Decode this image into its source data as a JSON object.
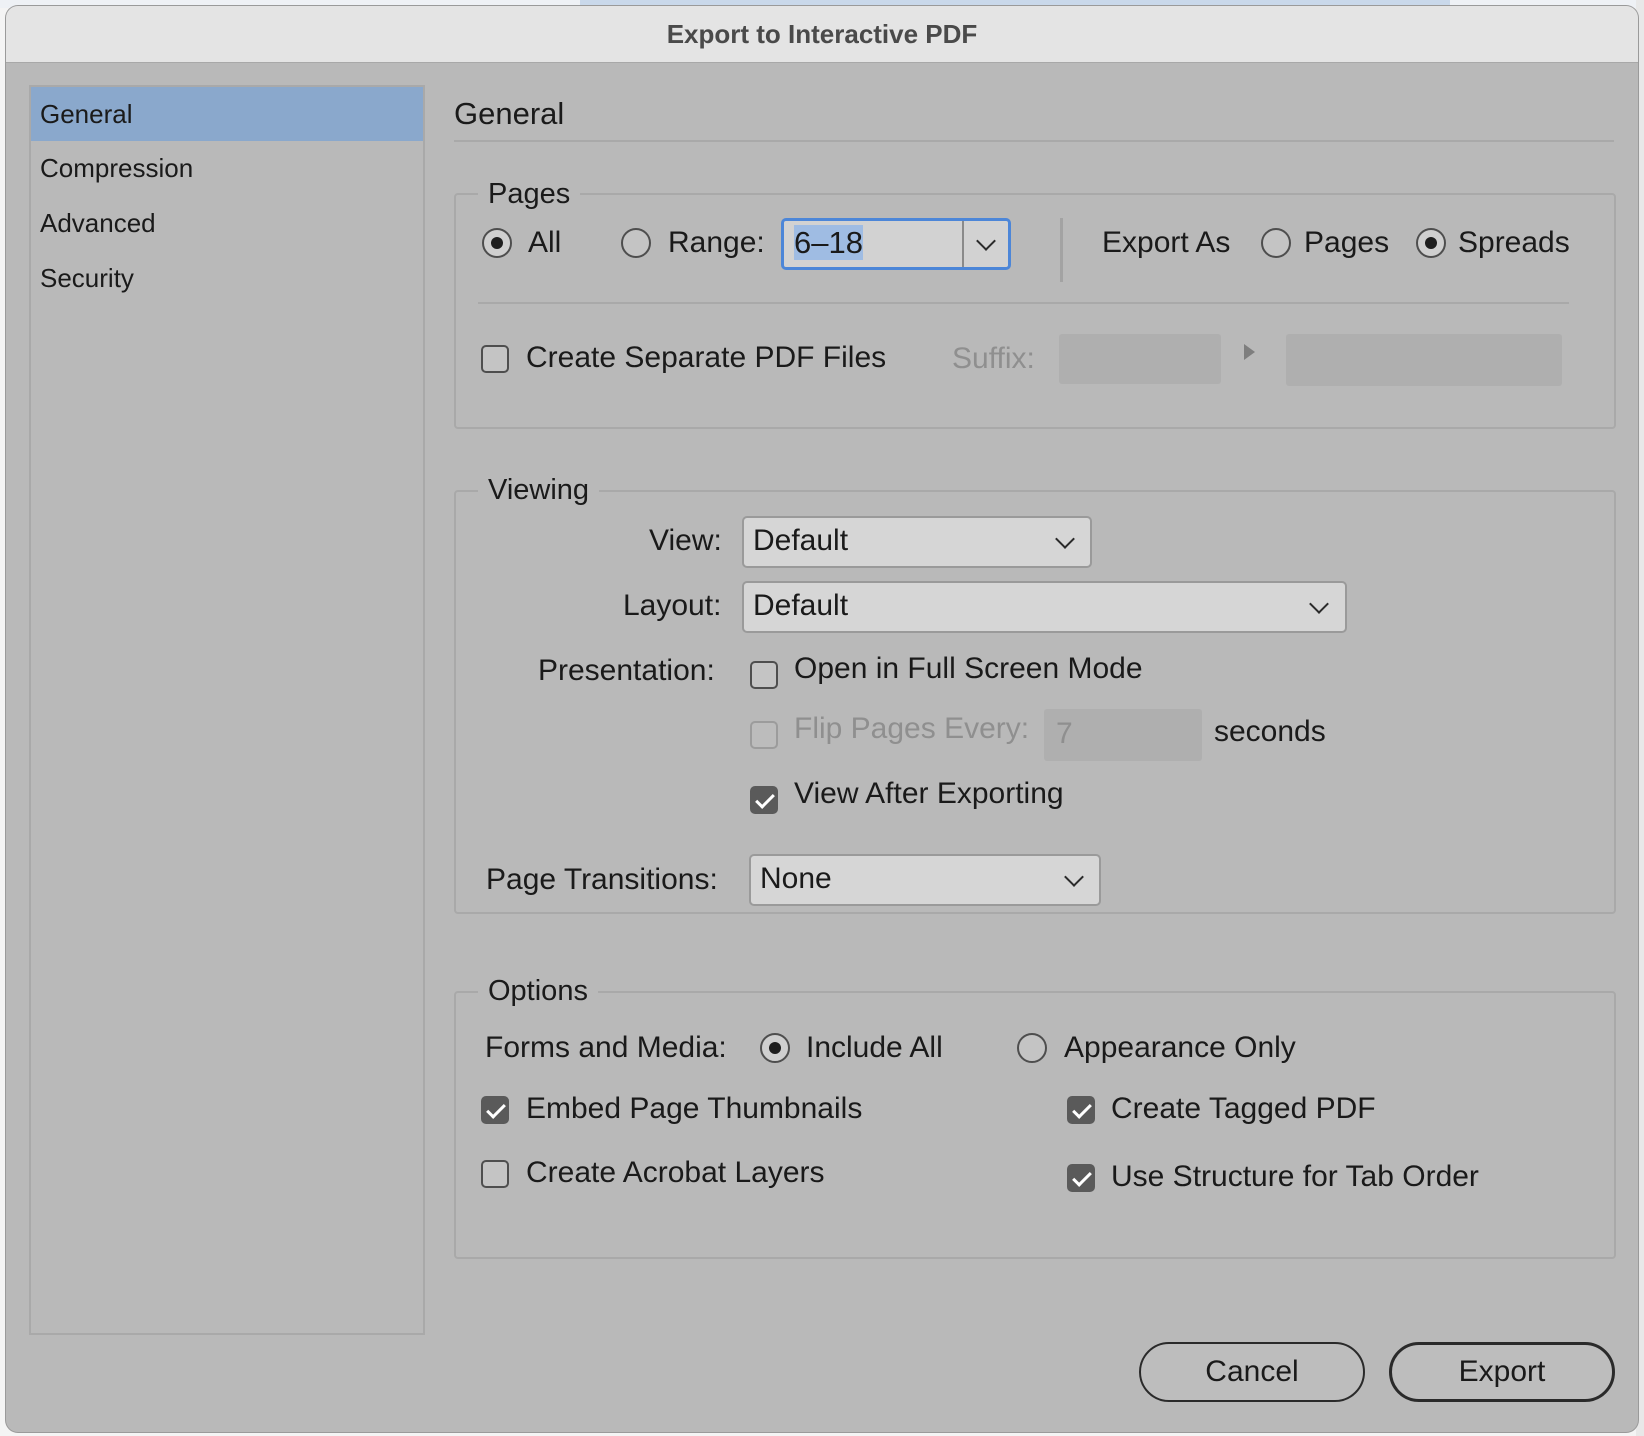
{
  "dialog": {
    "title": "Export to Interactive PDF"
  },
  "sidebar": {
    "items": [
      {
        "label": "General"
      },
      {
        "label": "Compression"
      },
      {
        "label": "Advanced"
      },
      {
        "label": "Security"
      }
    ]
  },
  "content": {
    "title": "General"
  },
  "pages": {
    "legend": "Pages",
    "all_label": "All",
    "range_label": "Range:",
    "range_value": "6–18",
    "export_as_label": "Export As",
    "pages_label": "Pages",
    "spreads_label": "Spreads",
    "selected_page_option": "All",
    "selected_export_as": "Spreads",
    "separate_files_label": "Create Separate PDF Files",
    "separate_files_checked": false,
    "suffix_label": "Suffix:"
  },
  "viewing": {
    "legend": "Viewing",
    "view_label": "View:",
    "view_value": "Default",
    "layout_label": "Layout:",
    "layout_value": "Default",
    "presentation_label": "Presentation:",
    "full_screen_label": "Open in Full Screen Mode",
    "full_screen_checked": false,
    "flip_label": "Flip Pages Every:",
    "flip_checked": false,
    "flip_value": "7",
    "seconds_label": "seconds",
    "view_after_label": "View After Exporting",
    "view_after_checked": true,
    "transitions_label": "Page Transitions:",
    "transitions_value": "None"
  },
  "options": {
    "legend": "Options",
    "forms_label": "Forms and Media:",
    "include_all_label": "Include All",
    "appearance_only_label": "Appearance Only",
    "forms_selected": "Include All",
    "thumbnails_label": "Embed Page Thumbnails",
    "thumbnails_checked": true,
    "acrobat_layers_label": "Create Acrobat Layers",
    "acrobat_layers_checked": false,
    "tagged_pdf_label": "Create Tagged PDF",
    "tagged_pdf_checked": true,
    "tab_order_label": "Use Structure for Tab Order",
    "tab_order_checked": true
  },
  "buttons": {
    "cancel": "Cancel",
    "export": "Export"
  },
  "colors": {
    "sidebar_selection": "#8aa8cc",
    "focus_ring": "#4c86d8",
    "dialog_bg": "#b9b9b9"
  }
}
